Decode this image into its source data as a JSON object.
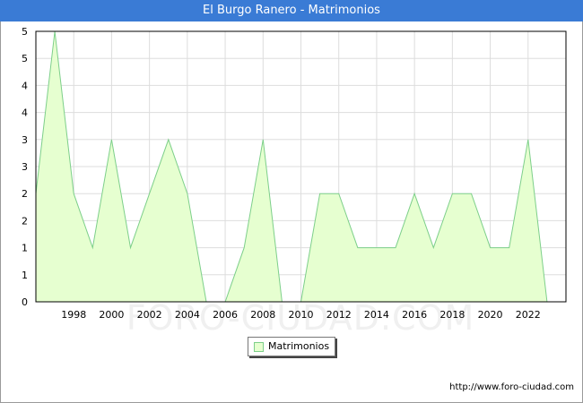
{
  "title": "El Burgo Ranero - Matrimonios",
  "footer_url": "http://www.foro-ciudad.com",
  "watermark": "FORO-CIUDAD.COM",
  "colors": {
    "title_bar": "#3a7bd5",
    "fill": "#e6ffd0",
    "line": "#7dcf8a",
    "grid": "#dddddd"
  },
  "chart_data": {
    "type": "area",
    "title": "El Burgo Ranero - Matrimonios",
    "xlabel": "",
    "ylabel": "",
    "x": [
      1996,
      1997,
      1998,
      1999,
      2000,
      2001,
      2002,
      2003,
      2004,
      2005,
      2006,
      2007,
      2008,
      2009,
      2010,
      2011,
      2012,
      2013,
      2014,
      2015,
      2016,
      2017,
      2018,
      2019,
      2020,
      2021,
      2022,
      2023
    ],
    "series": [
      {
        "name": "Matrimonios",
        "values": [
          2.0,
          5.0,
          2.0,
          1.0,
          3.0,
          1.0,
          2.0,
          3.0,
          2.0,
          0,
          0,
          1.0,
          3.0,
          0,
          0,
          2.0,
          2.0,
          1.0,
          1.0,
          1.0,
          2.0,
          1.0,
          2.0,
          2.0,
          1.0,
          1.0,
          3.0,
          0
        ]
      }
    ],
    "x_ticks": [
      "1998",
      "2000",
      "2002",
      "2004",
      "2006",
      "2008",
      "2010",
      "2012",
      "2014",
      "2016",
      "2018",
      "2020",
      "2022"
    ],
    "y_tick_labels": [
      "0",
      "1",
      "1",
      "2",
      "2",
      "3",
      "3",
      "4",
      "4",
      "5",
      "5"
    ],
    "xlim": [
      1996,
      2024
    ],
    "ylim": [
      0,
      5
    ],
    "grid": true,
    "legend": "bottom-center"
  }
}
